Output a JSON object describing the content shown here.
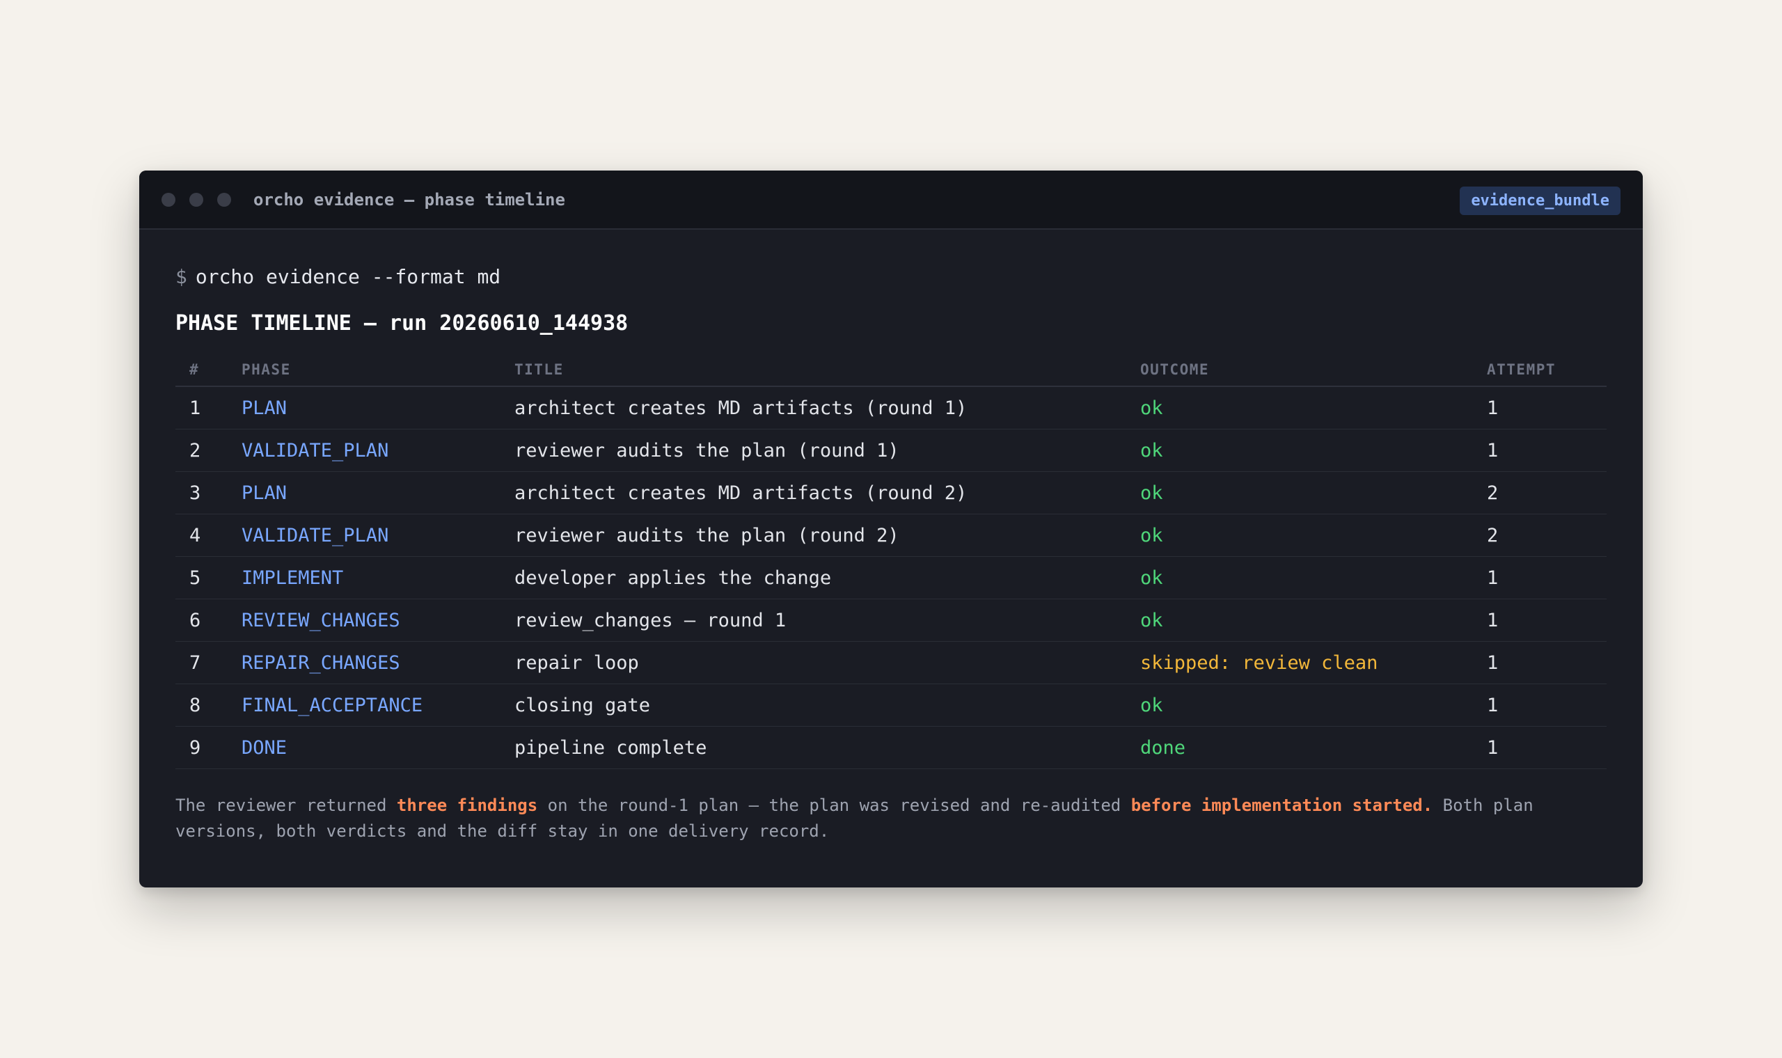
{
  "window": {
    "title": "orcho evidence — phase timeline",
    "badge": "evidence_bundle"
  },
  "terminal": {
    "prompt_symbol": "$",
    "command": "orcho evidence --format md",
    "heading": "PHASE TIMELINE — run 20260610_144938"
  },
  "table": {
    "headers": {
      "num": "#",
      "phase": "PHASE",
      "title": "TITLE",
      "outcome": "OUTCOME",
      "attempt": "ATTEMPT"
    },
    "rows": [
      {
        "num": "1",
        "phase": "PLAN",
        "title": "architect creates MD artifacts (round 1)",
        "outcome": "ok",
        "attempt": "1"
      },
      {
        "num": "2",
        "phase": "VALIDATE_PLAN",
        "title": "reviewer audits the plan (round 1)",
        "outcome": "ok",
        "attempt": "1"
      },
      {
        "num": "3",
        "phase": "PLAN",
        "title": "architect creates MD artifacts (round 2)",
        "outcome": "ok",
        "attempt": "2"
      },
      {
        "num": "4",
        "phase": "VALIDATE_PLAN",
        "title": "reviewer audits the plan (round 2)",
        "outcome": "ok",
        "attempt": "2"
      },
      {
        "num": "5",
        "phase": "IMPLEMENT",
        "title": "developer applies the change",
        "outcome": "ok",
        "attempt": "1"
      },
      {
        "num": "6",
        "phase": "REVIEW_CHANGES",
        "title": "review_changes — round 1",
        "outcome": "ok",
        "attempt": "1"
      },
      {
        "num": "7",
        "phase": "REPAIR_CHANGES",
        "title": "repair loop",
        "outcome": "skipped: review clean",
        "attempt": "1"
      },
      {
        "num": "8",
        "phase": "FINAL_ACCEPTANCE",
        "title": "closing gate",
        "outcome": "ok",
        "attempt": "1"
      },
      {
        "num": "9",
        "phase": "DONE",
        "title": "pipeline complete",
        "outcome": "done",
        "attempt": "1"
      }
    ]
  },
  "note": {
    "part1": "The reviewer returned ",
    "highlight1": "three findings",
    "part2": " on the round-1 plan — the plan was revised and re-audited ",
    "highlight2": "before implementation started.",
    "part3": " Both plan versions, both verdicts and the diff stay in one delivery record."
  },
  "colors": {
    "phase": "#79a7ff",
    "ok": "#4fd67a",
    "warn": "#f2b73a",
    "highlight": "#ff8a57"
  }
}
